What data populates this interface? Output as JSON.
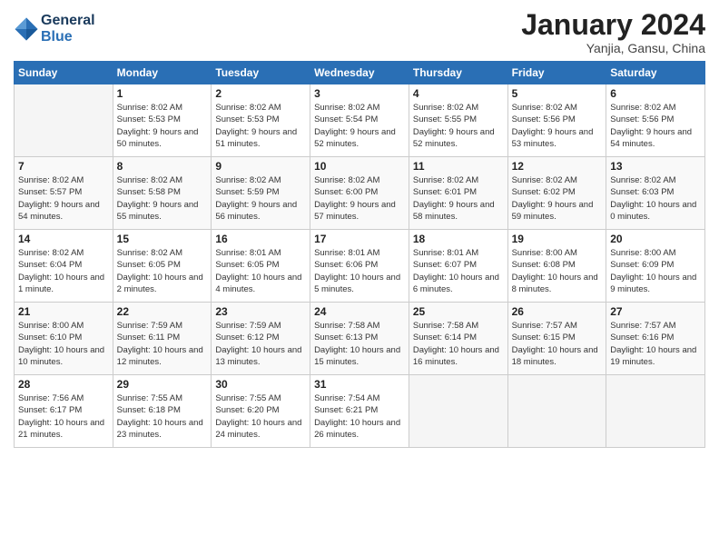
{
  "logo": {
    "line1": "General",
    "line2": "Blue"
  },
  "title": "January 2024",
  "subtitle": "Yanjia, Gansu, China",
  "weekdays": [
    "Sunday",
    "Monday",
    "Tuesday",
    "Wednesday",
    "Thursday",
    "Friday",
    "Saturday"
  ],
  "weeks": [
    [
      {
        "num": "",
        "sunrise": "",
        "sunset": "",
        "daylight": "",
        "empty": true
      },
      {
        "num": "1",
        "sunrise": "Sunrise: 8:02 AM",
        "sunset": "Sunset: 5:53 PM",
        "daylight": "Daylight: 9 hours and 50 minutes."
      },
      {
        "num": "2",
        "sunrise": "Sunrise: 8:02 AM",
        "sunset": "Sunset: 5:53 PM",
        "daylight": "Daylight: 9 hours and 51 minutes."
      },
      {
        "num": "3",
        "sunrise": "Sunrise: 8:02 AM",
        "sunset": "Sunset: 5:54 PM",
        "daylight": "Daylight: 9 hours and 52 minutes."
      },
      {
        "num": "4",
        "sunrise": "Sunrise: 8:02 AM",
        "sunset": "Sunset: 5:55 PM",
        "daylight": "Daylight: 9 hours and 52 minutes."
      },
      {
        "num": "5",
        "sunrise": "Sunrise: 8:02 AM",
        "sunset": "Sunset: 5:56 PM",
        "daylight": "Daylight: 9 hours and 53 minutes."
      },
      {
        "num": "6",
        "sunrise": "Sunrise: 8:02 AM",
        "sunset": "Sunset: 5:56 PM",
        "daylight": "Daylight: 9 hours and 54 minutes."
      }
    ],
    [
      {
        "num": "7",
        "sunrise": "Sunrise: 8:02 AM",
        "sunset": "Sunset: 5:57 PM",
        "daylight": "Daylight: 9 hours and 54 minutes."
      },
      {
        "num": "8",
        "sunrise": "Sunrise: 8:02 AM",
        "sunset": "Sunset: 5:58 PM",
        "daylight": "Daylight: 9 hours and 55 minutes."
      },
      {
        "num": "9",
        "sunrise": "Sunrise: 8:02 AM",
        "sunset": "Sunset: 5:59 PM",
        "daylight": "Daylight: 9 hours and 56 minutes."
      },
      {
        "num": "10",
        "sunrise": "Sunrise: 8:02 AM",
        "sunset": "Sunset: 6:00 PM",
        "daylight": "Daylight: 9 hours and 57 minutes."
      },
      {
        "num": "11",
        "sunrise": "Sunrise: 8:02 AM",
        "sunset": "Sunset: 6:01 PM",
        "daylight": "Daylight: 9 hours and 58 minutes."
      },
      {
        "num": "12",
        "sunrise": "Sunrise: 8:02 AM",
        "sunset": "Sunset: 6:02 PM",
        "daylight": "Daylight: 9 hours and 59 minutes."
      },
      {
        "num": "13",
        "sunrise": "Sunrise: 8:02 AM",
        "sunset": "Sunset: 6:03 PM",
        "daylight": "Daylight: 10 hours and 0 minutes."
      }
    ],
    [
      {
        "num": "14",
        "sunrise": "Sunrise: 8:02 AM",
        "sunset": "Sunset: 6:04 PM",
        "daylight": "Daylight: 10 hours and 1 minute."
      },
      {
        "num": "15",
        "sunrise": "Sunrise: 8:02 AM",
        "sunset": "Sunset: 6:05 PM",
        "daylight": "Daylight: 10 hours and 2 minutes."
      },
      {
        "num": "16",
        "sunrise": "Sunrise: 8:01 AM",
        "sunset": "Sunset: 6:05 PM",
        "daylight": "Daylight: 10 hours and 4 minutes."
      },
      {
        "num": "17",
        "sunrise": "Sunrise: 8:01 AM",
        "sunset": "Sunset: 6:06 PM",
        "daylight": "Daylight: 10 hours and 5 minutes."
      },
      {
        "num": "18",
        "sunrise": "Sunrise: 8:01 AM",
        "sunset": "Sunset: 6:07 PM",
        "daylight": "Daylight: 10 hours and 6 minutes."
      },
      {
        "num": "19",
        "sunrise": "Sunrise: 8:00 AM",
        "sunset": "Sunset: 6:08 PM",
        "daylight": "Daylight: 10 hours and 8 minutes."
      },
      {
        "num": "20",
        "sunrise": "Sunrise: 8:00 AM",
        "sunset": "Sunset: 6:09 PM",
        "daylight": "Daylight: 10 hours and 9 minutes."
      }
    ],
    [
      {
        "num": "21",
        "sunrise": "Sunrise: 8:00 AM",
        "sunset": "Sunset: 6:10 PM",
        "daylight": "Daylight: 10 hours and 10 minutes."
      },
      {
        "num": "22",
        "sunrise": "Sunrise: 7:59 AM",
        "sunset": "Sunset: 6:11 PM",
        "daylight": "Daylight: 10 hours and 12 minutes."
      },
      {
        "num": "23",
        "sunrise": "Sunrise: 7:59 AM",
        "sunset": "Sunset: 6:12 PM",
        "daylight": "Daylight: 10 hours and 13 minutes."
      },
      {
        "num": "24",
        "sunrise": "Sunrise: 7:58 AM",
        "sunset": "Sunset: 6:13 PM",
        "daylight": "Daylight: 10 hours and 15 minutes."
      },
      {
        "num": "25",
        "sunrise": "Sunrise: 7:58 AM",
        "sunset": "Sunset: 6:14 PM",
        "daylight": "Daylight: 10 hours and 16 minutes."
      },
      {
        "num": "26",
        "sunrise": "Sunrise: 7:57 AM",
        "sunset": "Sunset: 6:15 PM",
        "daylight": "Daylight: 10 hours and 18 minutes."
      },
      {
        "num": "27",
        "sunrise": "Sunrise: 7:57 AM",
        "sunset": "Sunset: 6:16 PM",
        "daylight": "Daylight: 10 hours and 19 minutes."
      }
    ],
    [
      {
        "num": "28",
        "sunrise": "Sunrise: 7:56 AM",
        "sunset": "Sunset: 6:17 PM",
        "daylight": "Daylight: 10 hours and 21 minutes."
      },
      {
        "num": "29",
        "sunrise": "Sunrise: 7:55 AM",
        "sunset": "Sunset: 6:18 PM",
        "daylight": "Daylight: 10 hours and 23 minutes."
      },
      {
        "num": "30",
        "sunrise": "Sunrise: 7:55 AM",
        "sunset": "Sunset: 6:20 PM",
        "daylight": "Daylight: 10 hours and 24 minutes."
      },
      {
        "num": "31",
        "sunrise": "Sunrise: 7:54 AM",
        "sunset": "Sunset: 6:21 PM",
        "daylight": "Daylight: 10 hours and 26 minutes."
      },
      {
        "num": "",
        "sunrise": "",
        "sunset": "",
        "daylight": "",
        "empty": true
      },
      {
        "num": "",
        "sunrise": "",
        "sunset": "",
        "daylight": "",
        "empty": true
      },
      {
        "num": "",
        "sunrise": "",
        "sunset": "",
        "daylight": "",
        "empty": true
      }
    ]
  ]
}
